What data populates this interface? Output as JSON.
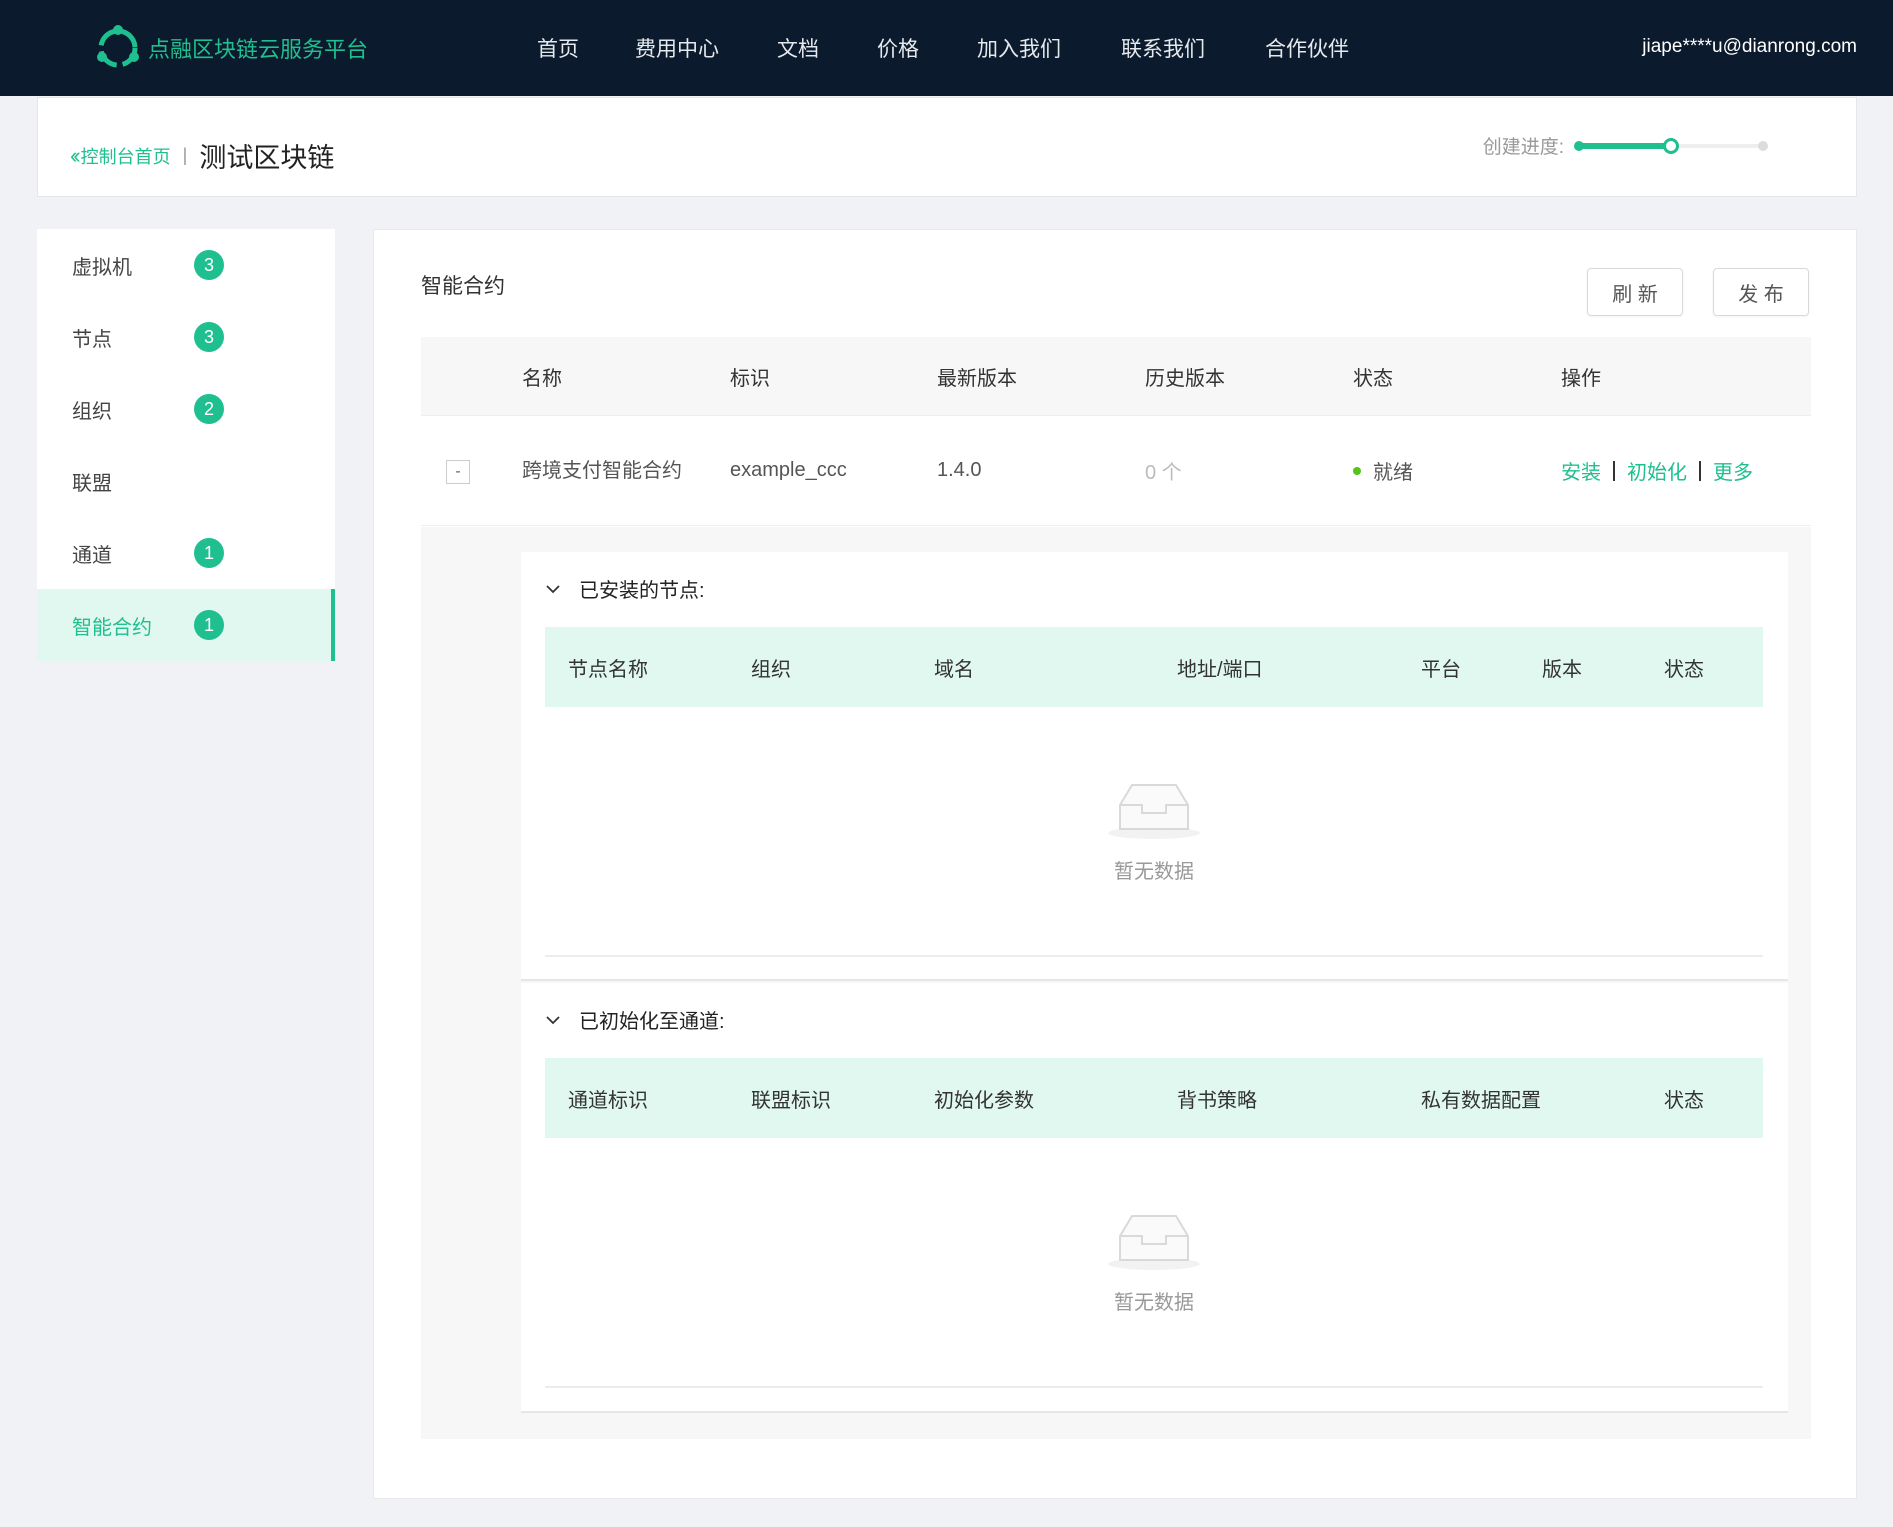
{
  "nav": {
    "logo_text": "点融区块链云服务平台",
    "items": [
      {
        "label": "首页"
      },
      {
        "label": "费用中心"
      },
      {
        "label": "文档"
      },
      {
        "label": "价格"
      },
      {
        "label": "加入我们"
      },
      {
        "label": "联系我们"
      },
      {
        "label": "合作伙伴"
      }
    ],
    "user": "jiape****u@dianrong.com"
  },
  "header": {
    "back_label": "控制台首页",
    "separator": "|",
    "title": "测试区块链",
    "progress_label": "创建进度:",
    "progress_fraction": 0.5
  },
  "sidebar": {
    "items": [
      {
        "label": "虚拟机",
        "count": "3"
      },
      {
        "label": "节点",
        "count": "3"
      },
      {
        "label": "组织",
        "count": "2"
      },
      {
        "label": "联盟",
        "count": ""
      },
      {
        "label": "通道",
        "count": "1"
      },
      {
        "label": "智能合约",
        "count": "1"
      }
    ]
  },
  "main": {
    "title": "智能合约",
    "refresh_label": "刷 新",
    "publish_label": "发 布",
    "columns": [
      "名称",
      "标识",
      "最新版本",
      "历史版本",
      "状态",
      "操作"
    ],
    "row": {
      "expand": "-",
      "name": "跨境支付智能合约",
      "id": "example_ccc",
      "version": "1.4.0",
      "history": "0 个",
      "status": "就绪",
      "ops": [
        "安装",
        "初始化",
        "更多"
      ]
    },
    "installed": {
      "title": "已安装的节点:",
      "columns": [
        "节点名称",
        "组织",
        "域名",
        "地址/端口",
        "平台",
        "版本",
        "状态"
      ],
      "empty": "暂无数据"
    },
    "initialized": {
      "title": "已初始化至通道:",
      "columns": [
        "通道标识",
        "联盟标识",
        "初始化参数",
        "背书策略",
        "私有数据配置",
        "状态"
      ],
      "empty": "暂无数据"
    }
  },
  "colors": {
    "accent": "#1fbf8f",
    "nav_bg": "#0b1a2c",
    "status_ready": "#52c41a"
  }
}
